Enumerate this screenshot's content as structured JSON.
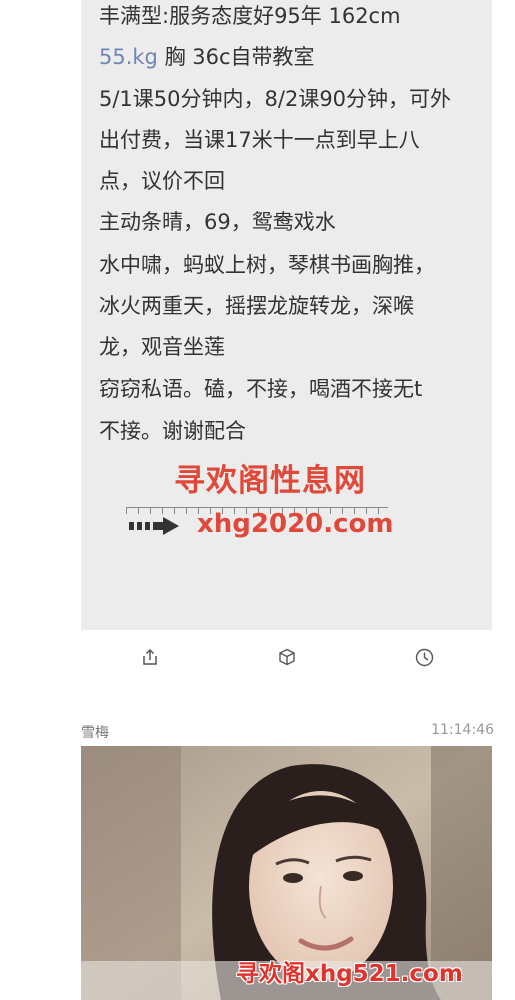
{
  "message": {
    "line1": "丰满型:服务态度好95年 162cm",
    "line2_accent": "55.kg",
    "line2_rest": " 胸 36c自带教室",
    "line3": "5/1课50分钟内，8/2课90分钟，可外",
    "line4": "出付费，当课17米十一点到早上八",
    "line5": "点，议价不回",
    "line6": "主动条晴，69，鸳鸯戏水",
    "line7": "水中啸，蚂蚁上树，琴棋书画胸推，",
    "line8": "冰火两重天，摇摆龙旋转龙，深喉",
    "line9": "龙，观音坐莲",
    "line10": "窃窃私语。磕，不接，喝酒不接无t",
    "line11": "不接。谢谢配合"
  },
  "watermark": {
    "title": "寻欢阁性息网",
    "url": "xhg2020.com",
    "bottom": "寻欢阁xhg521.com"
  },
  "actions": {
    "share_icon": "share-icon",
    "cube_icon": "cube-icon",
    "clock_icon": "clock-icon"
  },
  "post": {
    "author": "雪梅",
    "time": "11:14:46"
  },
  "colors": {
    "card_bg": "#ececec",
    "accent": "#6f86b6",
    "watermark_red": "#e0483a"
  }
}
